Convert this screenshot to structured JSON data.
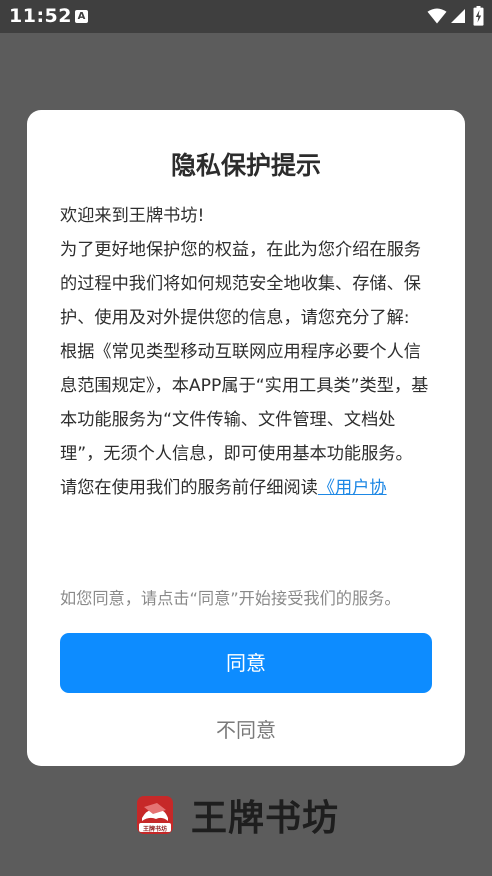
{
  "status_bar": {
    "time": "11:52",
    "notification_letter": "A",
    "icons": [
      "wifi-icon",
      "cellular-signal-icon",
      "battery-charging-icon"
    ]
  },
  "dialog": {
    "title": "隐私保护提示",
    "paragraphs": [
      "欢迎来到王牌书坊!",
      "为了更好地保护您的权益，在此为您介绍在服务的过程中我们将如何规范安全地收集、存储、保护、使用及对外提供您的信息，请您充分了解:",
      "根据《常见类型移动互联网应用程序必要个人信息范围规定》，本APP属于“实用工具类”类型，基本功能服务为“文件传输、文件管理、文档处理”，无须个人信息，即可使用基本功能服务。"
    ],
    "read_prompt": "请您在使用我们的服务前仔细阅读",
    "agreement_link": "《用户协",
    "note": "如您同意，请点击“同意”开始接受我们的服务。",
    "agree_label": "同意",
    "disagree_label": "不同意"
  },
  "brand": {
    "name": "王牌书坊",
    "logo_caption": "王牌书坊",
    "logo_icon": "book-logo-icon"
  },
  "colors": {
    "overlay": "#5c5c5c",
    "status_bar": "#3f3f3f",
    "accent": "#0d8cff",
    "link": "#1e88e5",
    "logo_red": "#c62828"
  }
}
